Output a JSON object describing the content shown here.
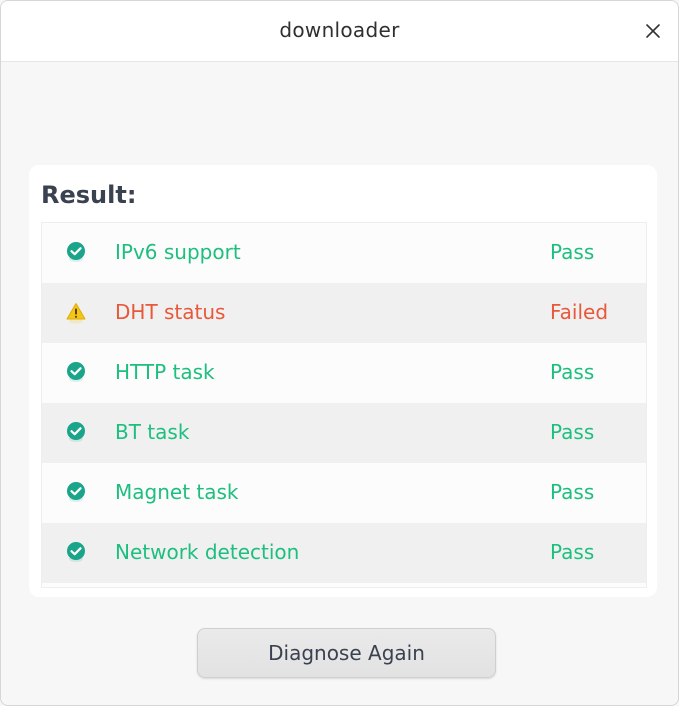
{
  "window": {
    "title": "downloader"
  },
  "result": {
    "heading": "Result:",
    "rows": [
      {
        "label": "IPv6 support",
        "status": "Pass",
        "icon": "check-circle-icon"
      },
      {
        "label": "DHT status",
        "status": "Failed",
        "icon": "warning-icon"
      },
      {
        "label": "HTTP task",
        "status": "Pass",
        "icon": "check-circle-icon"
      },
      {
        "label": "BT task",
        "status": "Pass",
        "icon": "check-circle-icon"
      },
      {
        "label": "Magnet task",
        "status": "Pass",
        "icon": "check-circle-icon"
      },
      {
        "label": "Network detection",
        "status": "Pass",
        "icon": "check-circle-icon"
      }
    ]
  },
  "actions": {
    "diagnose_again_label": "Diagnose Again"
  },
  "colors": {
    "pass": "#1dbf7e",
    "fail": "#e8583a",
    "warning": "#f5c518",
    "check_icon": "#1aa58a"
  }
}
